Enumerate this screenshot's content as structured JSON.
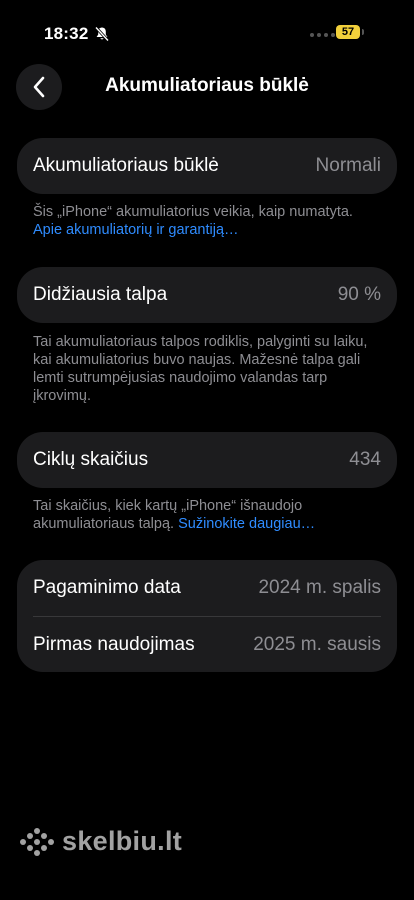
{
  "status": {
    "time": "18:32",
    "battery_level": "57"
  },
  "header": {
    "title": "Akumuliatoriaus būklė"
  },
  "health": {
    "label": "Akumuliatoriaus būklė",
    "value": "Normali",
    "note": "Šis „iPhone“ akumuliatorius veikia, kaip numatyta.",
    "link": "Apie akumuliatorių ir garantiją…"
  },
  "capacity": {
    "label": "Didžiausia talpa",
    "value": "90 %",
    "note": "Tai akumuliatoriaus talpos rodiklis, palyginti su laiku, kai akumuliatorius buvo naujas. Mažesnė talpa gali lemti sutrumpėjusias naudojimo valandas tarp įkrovimų."
  },
  "cycles": {
    "label": "Ciklų skaičius",
    "value": "434",
    "note": "Tai skaičius, kiek kartų „iPhone“ išnaudojo akumuliatoriaus talpą.",
    "link": "Sužinokite daugiau…"
  },
  "dates": {
    "manufacture_label": "Pagaminimo data",
    "manufacture_value": "2024 m. spalis",
    "first_use_label": "Pirmas naudojimas",
    "first_use_value": "2025 m. sausis"
  },
  "watermark": {
    "text": "skelbiu.lt"
  },
  "colors": {
    "background": "#000000",
    "card": "#1c1c1e",
    "secondary_text": "#8e8e93",
    "link": "#2f8cff",
    "battery": "#f2d03b"
  }
}
